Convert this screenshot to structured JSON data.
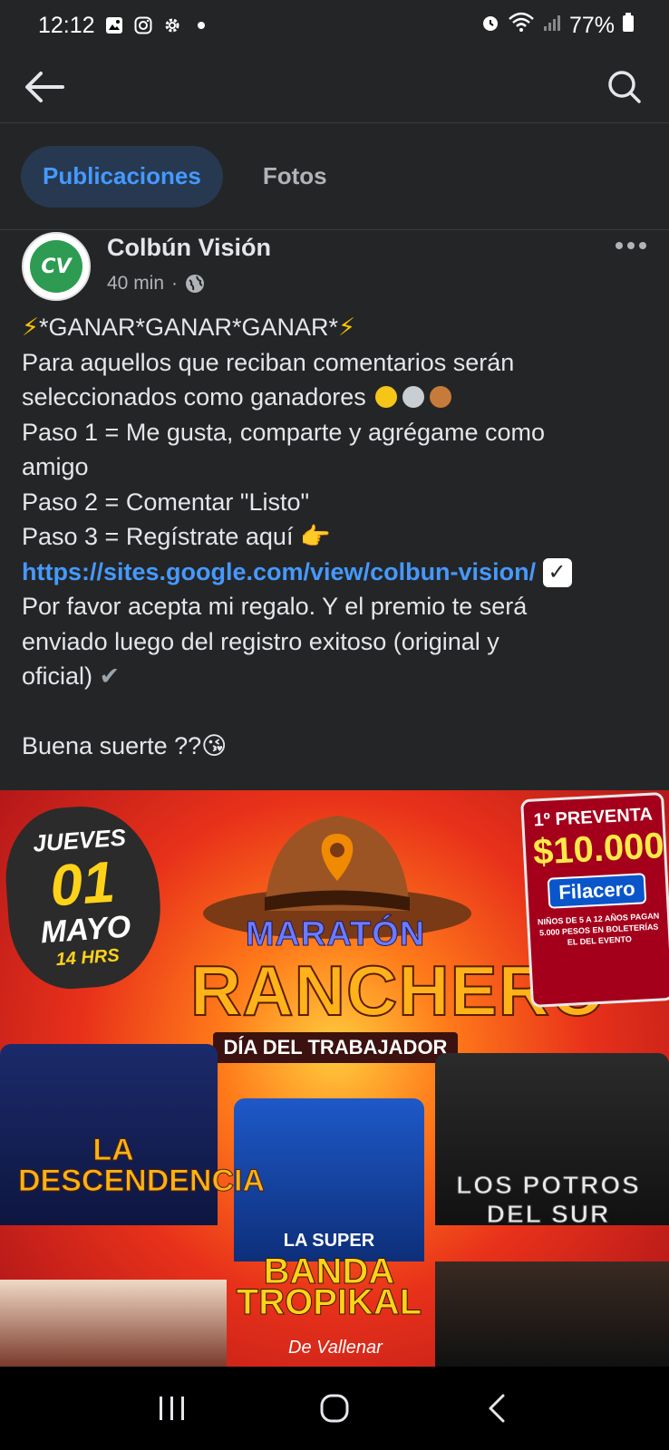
{
  "status_bar": {
    "time": "12:12",
    "battery": "77%"
  },
  "tabs": [
    {
      "label": "Publicaciones",
      "active": true
    },
    {
      "label": "Fotos",
      "active": false
    }
  ],
  "post": {
    "author": "Colbún Visión",
    "time": "40 min",
    "line1": "*GANAR*GANAR*GANAR*",
    "line2": "Para aquellos que reciban comentarios serán",
    "line3": "seleccionados como ganadores",
    "line4": "Paso 1 = Me gusta, comparte y agrégame como",
    "line5": "amigo",
    "line6": "Paso 2 = Comentar \"Listo\"",
    "line7": "Paso 3 = Regístrate aquí",
    "link": "https://sites.google.com/view/colbun-vision/",
    "line9": "Por favor acepta mi regalo. Y el premio te será",
    "line10": "enviado luego del registro exitoso (original y",
    "line11": "oficial)",
    "line13": "Buena suerte ??"
  },
  "image": {
    "date_day_name": "JUEVES",
    "date_day": "01",
    "date_month": "MAYO",
    "date_time": "14 HRS",
    "title_top": "MARATÓN",
    "title_main": "RANCHERO",
    "title_sub": "DÍA DEL TRABAJADOR",
    "presale": "1º PREVENTA",
    "price": "$10.000",
    "ticketer": "Filacero",
    "kids_note": "NIÑOS DE 5 A 12 AÑOS PAGAN 5.000 PESOS EN BOLETERÍAS EL DEL EVENTO",
    "band1": "LA DESCENDENCIA",
    "band2": "LOS POTROS DEL SUR",
    "band3_l1": "LA SUPER",
    "band3_l2": "BANDA",
    "band3_l3": "TROPIKAL",
    "band3_sub": "De Vallenar"
  },
  "colors": {
    "background": "#242526",
    "link": "#4599ff",
    "active_tab_bg": "#263951"
  }
}
